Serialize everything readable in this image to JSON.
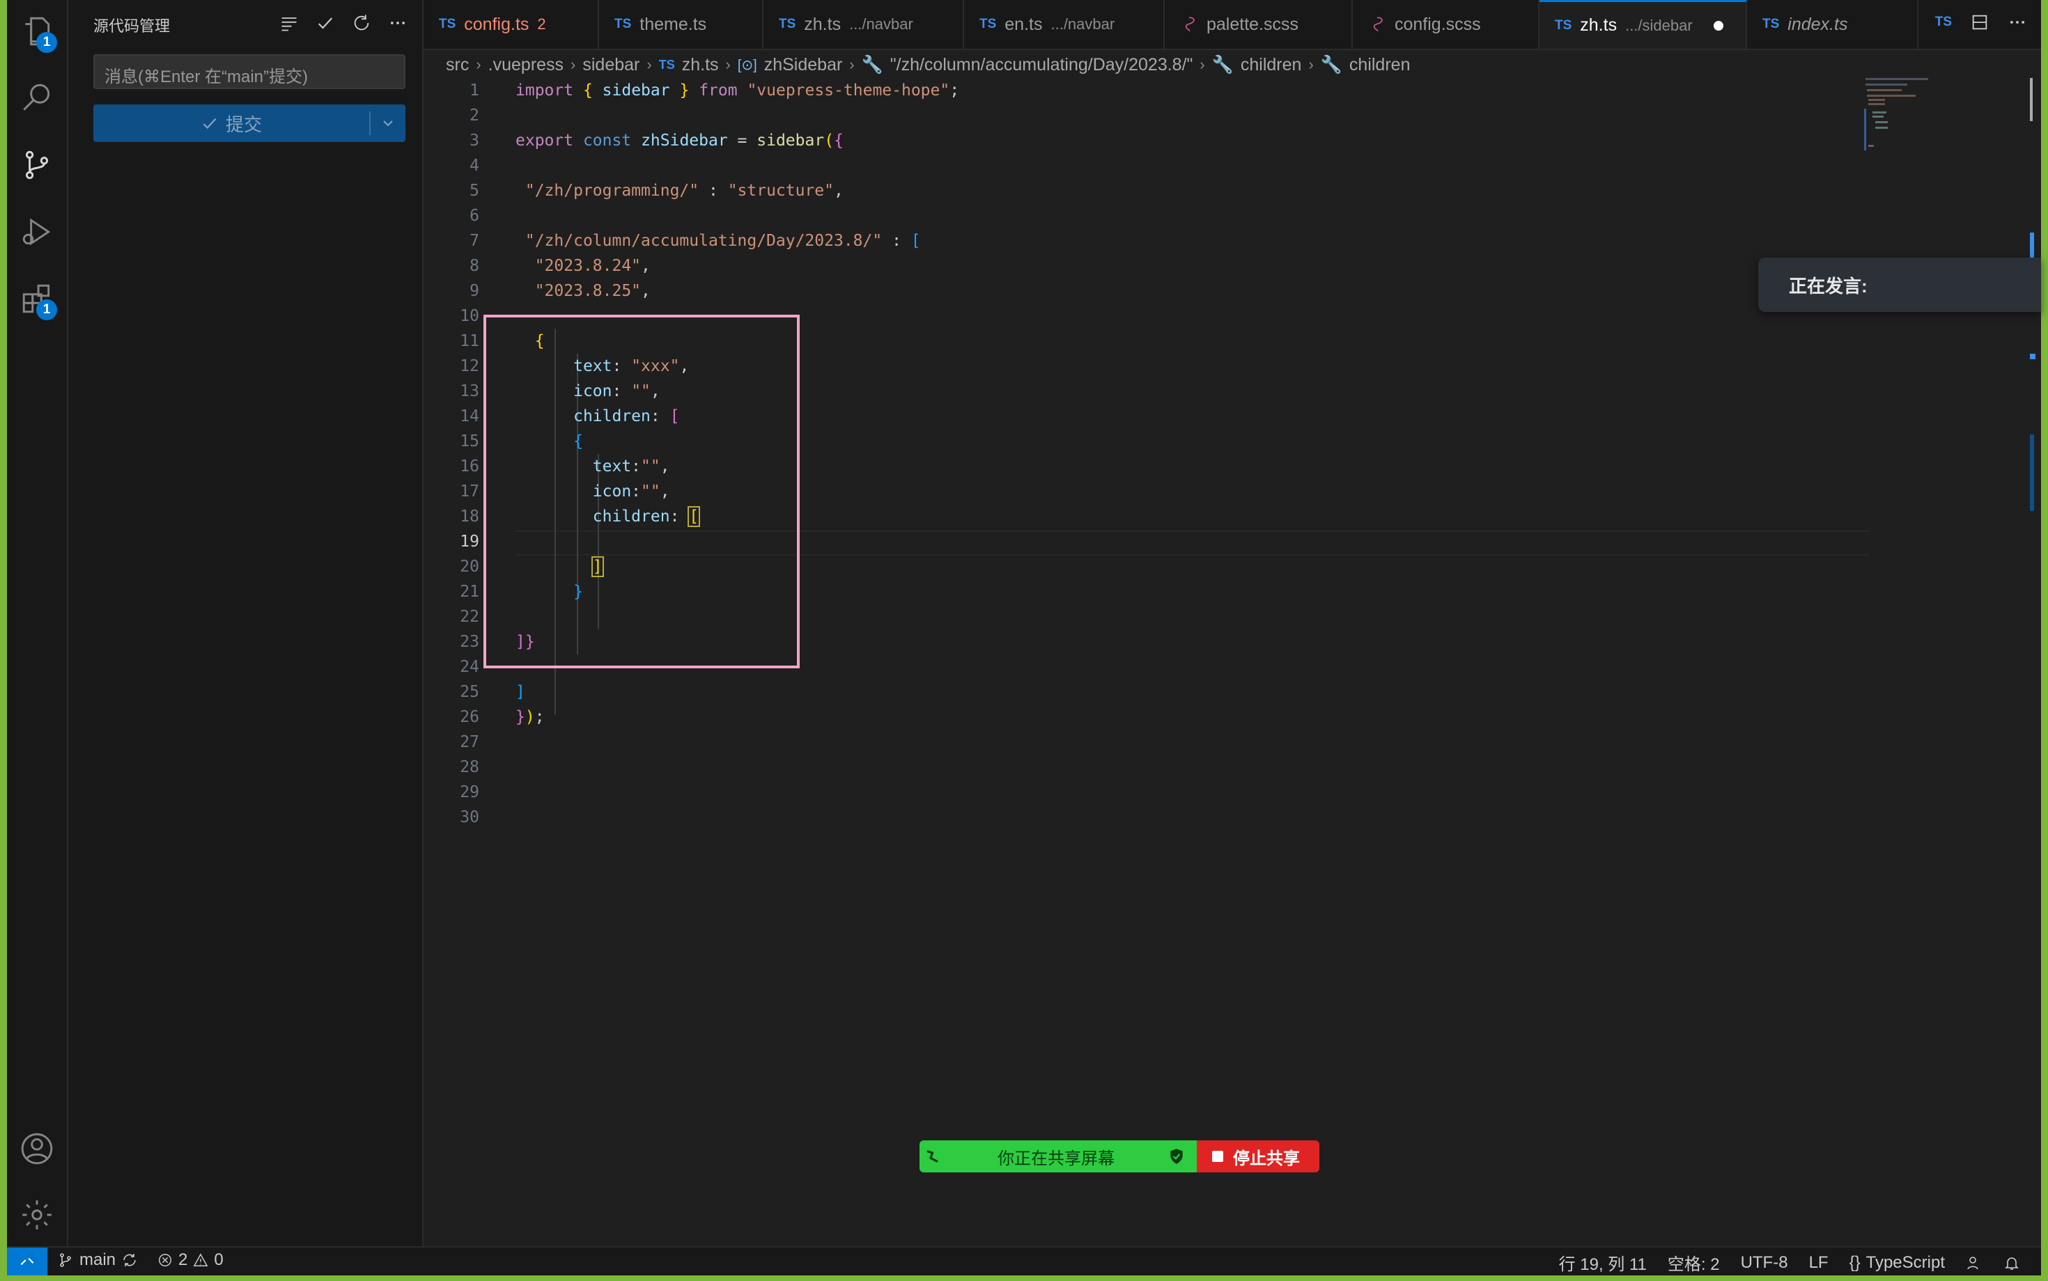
{
  "sidebar": {
    "title": "源代码管理",
    "commit_placeholder": "消息(⌘Enter 在“main”提交)",
    "commit_label": "提交",
    "badges": {
      "explorer": "1",
      "extensions": "1"
    }
  },
  "tabs": [
    {
      "name": "config.ts",
      "sub": "",
      "count": "2"
    },
    {
      "name": "theme.ts",
      "sub": ""
    },
    {
      "name": "zh.ts",
      "sub": ".../navbar"
    },
    {
      "name": "en.ts",
      "sub": ".../navbar"
    },
    {
      "name": "palette.scss",
      "sub": ""
    },
    {
      "name": "config.scss",
      "sub": ""
    },
    {
      "name": "zh.ts",
      "sub": ".../sidebar"
    },
    {
      "name": "index.ts",
      "sub": ""
    }
  ],
  "ts_label": "TS",
  "breadcrumb": [
    "src",
    ".vuepress",
    "sidebar",
    "zh.ts",
    "zhSidebar",
    "\"/zh/column/accumulating/Day/2023.8/\"",
    "children",
    "children"
  ],
  "line_numbers": [
    "1",
    "2",
    "3",
    "4",
    "5",
    "6",
    "7",
    "8",
    "9",
    "10",
    "11",
    "12",
    "13",
    "14",
    "15",
    "16",
    "17",
    "18",
    "19",
    "20",
    "21",
    "22",
    "23",
    "24",
    "25",
    "26",
    "27",
    "28",
    "29",
    "30"
  ],
  "code": {
    "l1": [
      "import",
      "{",
      "sidebar",
      "}",
      "from",
      "\"vuepress-theme-hope\"",
      ";"
    ],
    "l3": [
      "export",
      "const",
      "zhSidebar",
      "=",
      "sidebar",
      "(",
      "{"
    ],
    "l5": [
      "\"/zh/programming/\"",
      ":",
      "\"structure\"",
      ","
    ],
    "l7": [
      "\"/zh/column/accumulating/Day/2023.8/\"",
      ":",
      "["
    ],
    "l8": [
      "\"2023.8.24\"",
      ","
    ],
    "l9": [
      "\"2023.8.25\"",
      ","
    ],
    "l11": [
      "{"
    ],
    "l12": [
      "text",
      ":",
      "\"xxx\"",
      ","
    ],
    "l13": [
      "icon",
      ":",
      "\"\"",
      ","
    ],
    "l14": [
      "children",
      ":",
      "["
    ],
    "l15": [
      "{"
    ],
    "l16": [
      "text",
      ":",
      "\"\"",
      ","
    ],
    "l17": [
      "icon",
      ":",
      "\"\"",
      ","
    ],
    "l18": [
      "children",
      ":",
      "["
    ],
    "l20": [
      "]"
    ],
    "l21": [
      "}"
    ],
    "l23": [
      "]}"
    ],
    "l25": [
      "]"
    ],
    "l26": [
      "}",
      ")",
      ";"
    ]
  },
  "speaking": "正在发言:",
  "share": {
    "status": "你正在共享屏幕",
    "stop": "停止共享"
  },
  "status": {
    "branch": "main",
    "errors": "2",
    "warnings": "0",
    "position": "行 19, 列 11",
    "spaces": "空格: 2",
    "encoding": "UTF-8",
    "eol": "LF",
    "language": "TypeScript"
  }
}
